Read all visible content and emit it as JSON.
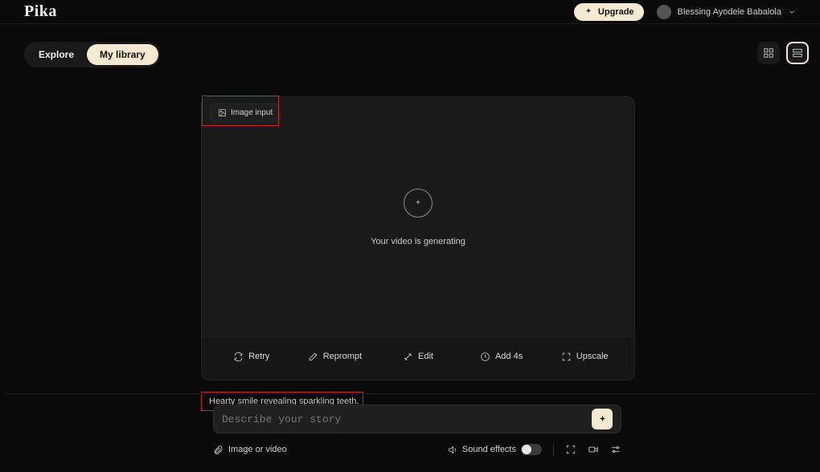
{
  "header": {
    "brand": "Pika",
    "upgrade_label": "Upgrade",
    "user_name": "Blessing Ayodele Babalola"
  },
  "nav": {
    "explore": "Explore",
    "library": "My library"
  },
  "card": {
    "image_input_label": "Image input",
    "generating_text": "Your video is generating",
    "actions": {
      "retry": "Retry",
      "reprompt": "Reprompt",
      "edit": "Edit",
      "add4s": "Add 4s",
      "upscale": "Upscale"
    },
    "caption": "Hearty smile revealing sparkling teeth."
  },
  "prompt": {
    "placeholder": "Describe your story",
    "attach_label": "Image or video",
    "sound_label": "Sound effects"
  }
}
